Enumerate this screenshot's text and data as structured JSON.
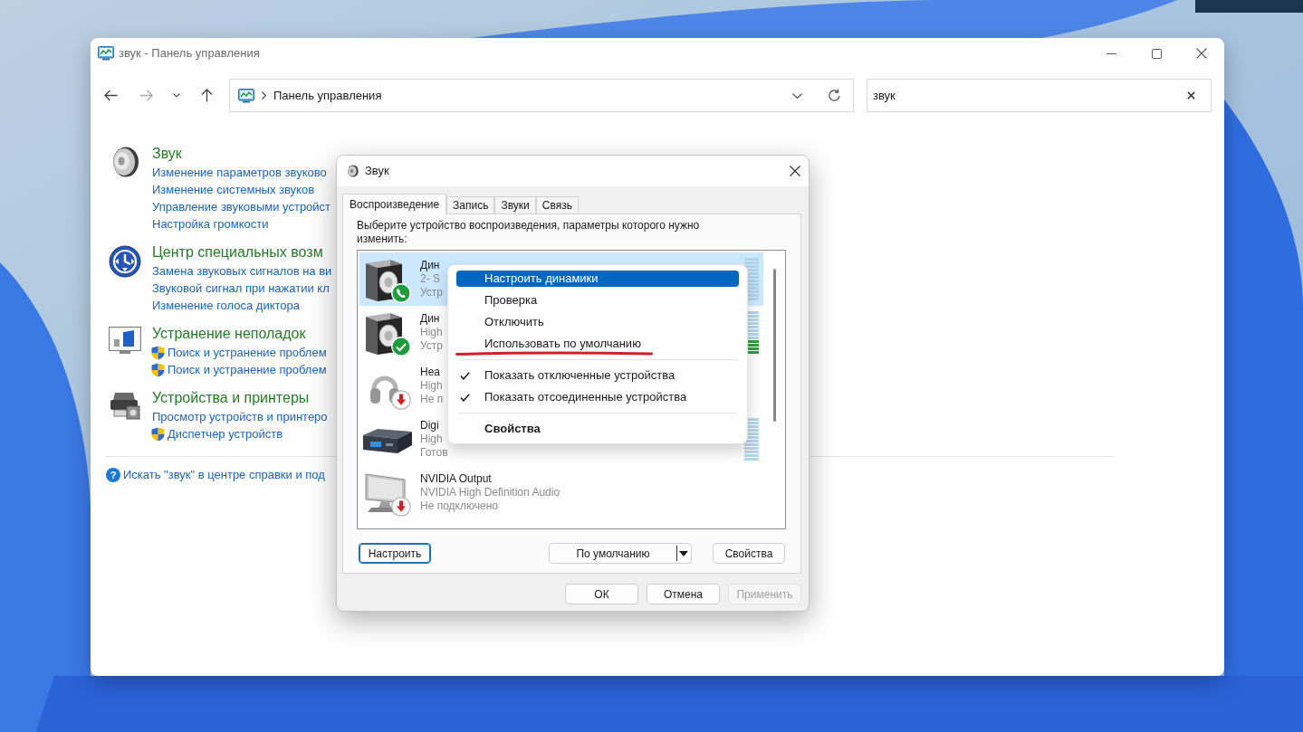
{
  "window": {
    "title": "звук - Панель управления"
  },
  "navigation": {
    "back": {
      "disabled": false
    },
    "forward": {
      "disabled": true
    }
  },
  "address_bar": {
    "path": [
      "Панель управления"
    ]
  },
  "search": {
    "value": "звук"
  },
  "categories": [
    {
      "kind": "sound",
      "title": "Звук",
      "links": [
        {
          "text": "Изменение параметров звуково",
          "shield": false
        },
        {
          "text": "Изменение системных звуков",
          "shield": false
        },
        {
          "text": "Управление звуковыми устройст",
          "shield": false
        },
        {
          "text": "Настройка громкости",
          "shield": false
        }
      ]
    },
    {
      "kind": "accessibility",
      "title": "Центр специальных возм",
      "links": [
        {
          "text": "Замена звуковых сигналов на ви",
          "shield": false
        },
        {
          "text": "Звуковой сигнал при нажатии кл",
          "shield": false
        },
        {
          "text": "Изменение голоса диктора",
          "shield": false
        }
      ]
    },
    {
      "kind": "troubleshooting",
      "title": "Устранение неполадок",
      "links": [
        {
          "text": "Поиск и устранение проблем",
          "shield": true
        },
        {
          "text": "Поиск и устранение проблем",
          "shield": true
        }
      ]
    },
    {
      "kind": "devices",
      "title": "Устройства и принтеры",
      "links": [
        {
          "text": "Просмотр устройств и принтеро",
          "shield": false
        },
        {
          "text": "Диспетчер устройств",
          "shield": true
        }
      ]
    }
  ],
  "help_link": {
    "icon": "?",
    "text": "Искать \"звук\" в центре справки и под"
  },
  "dialog": {
    "title": "Звук",
    "tabs": [
      {
        "label": "Воспроизведение",
        "selected": true
      },
      {
        "label": "Запись",
        "selected": false
      },
      {
        "label": "Звуки",
        "selected": false
      },
      {
        "label": "Связь",
        "selected": false
      }
    ],
    "instruction": "Выберите устройство воспроизведения, параметры которого нужно изменить:",
    "devices": [
      {
        "kind": "speaker",
        "badge": {
          "kind": "phone"
        },
        "name": "Дин",
        "driver": "2- S",
        "status": "Устр",
        "level": 0,
        "selected": true
      },
      {
        "kind": "speaker",
        "badge": {
          "kind": "check"
        },
        "name": "Дин",
        "driver": "High",
        "status": "Устр",
        "level": 0.3,
        "selected": false
      },
      {
        "kind": "headphones",
        "badge": {
          "kind": "down_arrow"
        },
        "name": "Hea",
        "driver": "High",
        "status": "Не п",
        "selected": false
      },
      {
        "kind": "receiver",
        "name": "Digi",
        "driver": "High",
        "status": "Готов",
        "level": 0,
        "selected": false
      },
      {
        "kind": "monitor",
        "badge": {
          "kind": "down_arrow"
        },
        "name": "NVIDIA Output",
        "driver": "NVIDIA High Definition Audio",
        "status": "Не подключено",
        "selected": false
      }
    ],
    "panel_buttons": [
      {
        "kind": "plain",
        "label": "Настроить",
        "focused": true
      },
      {
        "kind": "split",
        "label": "По умолчанию",
        "focused": false
      },
      {
        "kind": "plain",
        "label": "Свойства",
        "focused": false
      }
    ],
    "footer_buttons": [
      {
        "label": "ОК",
        "disabled": false
      },
      {
        "label": "Отмена",
        "disabled": false
      },
      {
        "label": "Применить",
        "disabled": true
      }
    ]
  },
  "context_menu": {
    "items": [
      {
        "kind": "item",
        "label": "Настроить динамики",
        "selected": true,
        "checked": false,
        "default": false,
        "underlined": false
      },
      {
        "kind": "item",
        "label": "Проверка",
        "selected": false,
        "checked": false,
        "default": false,
        "underlined": false
      },
      {
        "kind": "item",
        "label": "Отключить",
        "selected": false,
        "checked": false,
        "default": false,
        "underlined": false
      },
      {
        "kind": "item",
        "label": "Использовать по умолчанию",
        "selected": false,
        "checked": false,
        "default": false,
        "underlined": true
      },
      {
        "kind": "separator"
      },
      {
        "kind": "item",
        "label": "Показать отключенные устройства",
        "selected": false,
        "checked": true,
        "default": false,
        "underlined": false
      },
      {
        "kind": "item",
        "label": "Показать отсоединенные устройства",
        "selected": false,
        "checked": true,
        "default": false,
        "underlined": false
      },
      {
        "kind": "separator"
      },
      {
        "kind": "item",
        "label": "Свойства",
        "selected": false,
        "checked": false,
        "default": true,
        "underlined": false
      }
    ]
  }
}
